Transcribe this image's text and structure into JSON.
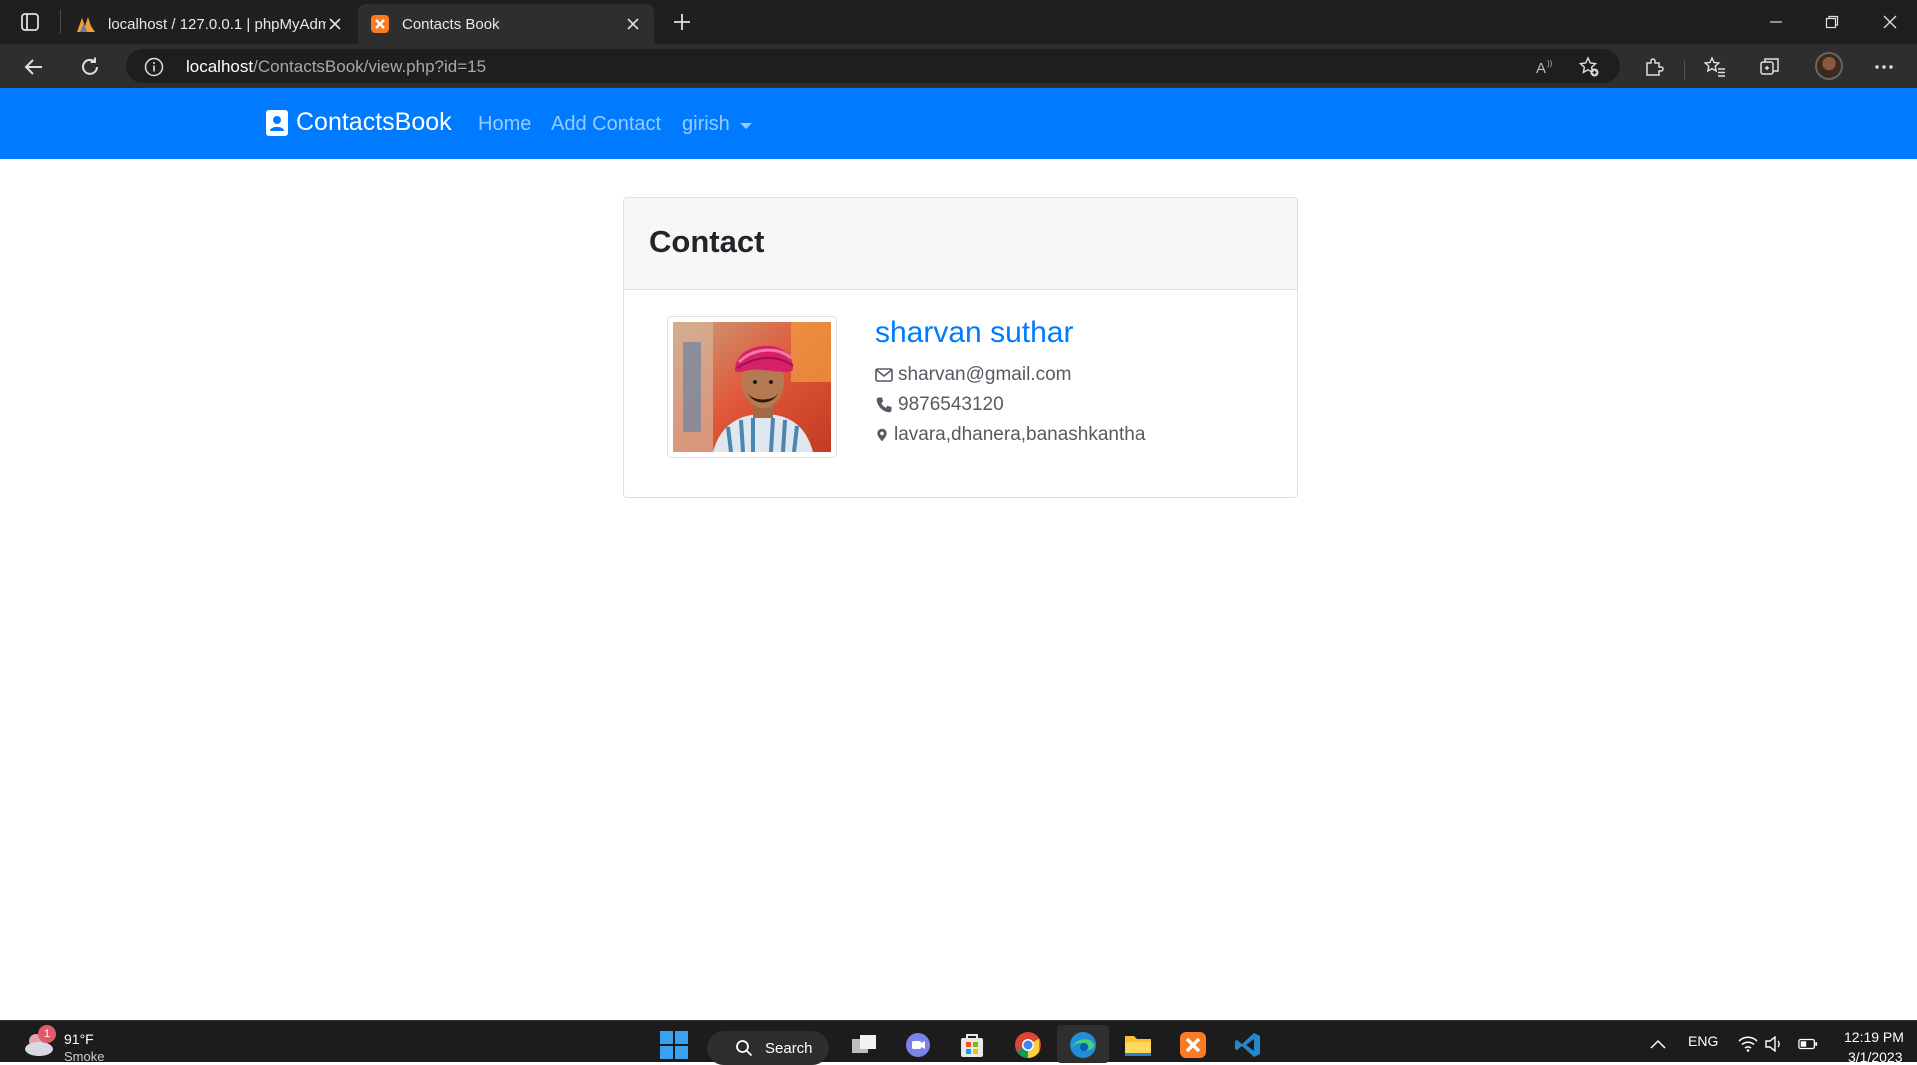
{
  "browser": {
    "tabs": [
      {
        "title": "localhost / 127.0.0.1 | phpMyAdmin",
        "icon": "phpmyadmin-icon",
        "active": false
      },
      {
        "title": "Contacts Book",
        "icon": "xampp-icon",
        "active": true
      }
    ],
    "url": {
      "host": "localhost",
      "path": "/ContactsBook/view.php?id=15"
    }
  },
  "navbar": {
    "brand": "ContactsBook",
    "links": {
      "home": "Home",
      "add_contact": "Add Contact",
      "user": "girish"
    },
    "color": "#007bff"
  },
  "card": {
    "header": "Contact",
    "contact": {
      "name": "sharvan suthar",
      "email": "sharvan@gmail.com",
      "phone": "9876543120",
      "address": "lavara,dhanera,banashkantha"
    }
  },
  "taskbar": {
    "weather": {
      "temp": "91°F",
      "condition": "Smoke",
      "badge": "1"
    },
    "search_label": "Search",
    "language": "ENG",
    "time": "12:19 PM",
    "date": "3/1/2023"
  }
}
